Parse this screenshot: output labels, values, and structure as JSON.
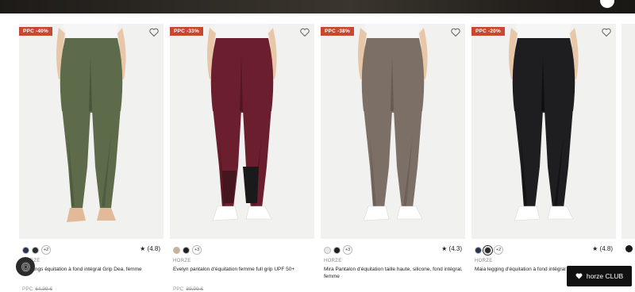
{
  "products": [
    {
      "badge": "PPC -40%",
      "rating": "★ (4.8)",
      "more_colors": "+2",
      "swatches": [
        "#2b3350",
        "#2b2b2b"
      ],
      "selected": -1,
      "brand": "HORZE",
      "name": "Leggings équitation à fond intégral Grip Dea, femme",
      "price_label": "PPC",
      "price_old": "64,99 €",
      "pants_color": "#5d6b4a",
      "pants_shade": "#4a5639"
    },
    {
      "badge": "PPC -33%",
      "rating": "",
      "more_colors": "+3",
      "swatches": [
        "#c9b391",
        "#1f1f1f"
      ],
      "selected": -1,
      "brand": "HORZE",
      "name": "Evelyn pantalon d'équitation femme full grip UPF 50+",
      "price_label": "PPC",
      "price_old": "89,99 €",
      "pants_color": "#6b1f2e",
      "pants_shade": "#521522"
    },
    {
      "badge": "PPC -38%",
      "rating": "★ (4.3)",
      "more_colors": "+3",
      "swatches": [
        "#e9e9e9",
        "#1f1f1f"
      ],
      "selected": -1,
      "brand": "HORZE",
      "name": "Mira Pantalon d'équitation taille haute, silicone, fond intégral, femme",
      "price_label": "",
      "price_old": "",
      "pants_color": "#7c7066",
      "pants_shade": "#665b52"
    },
    {
      "badge": "PPC -20%",
      "rating": "★ (4.8)",
      "more_colors": "+2",
      "swatches": [
        "#2b3350",
        "#2a2a2a"
      ],
      "selected": 1,
      "brand": "HORZE",
      "name": "Maia legging d'équitation à fond intégral d",
      "price_label": "",
      "price_old": "",
      "pants_color": "#1e1e20",
      "pants_shade": "#0f0f10"
    }
  ],
  "club_button": {
    "label": "horze CLUB",
    "icon": "heart-icon"
  },
  "fab": {
    "icon": "fingerprint-icon"
  },
  "colors": {
    "badge": "#c8472f",
    "dark": "#111111"
  }
}
